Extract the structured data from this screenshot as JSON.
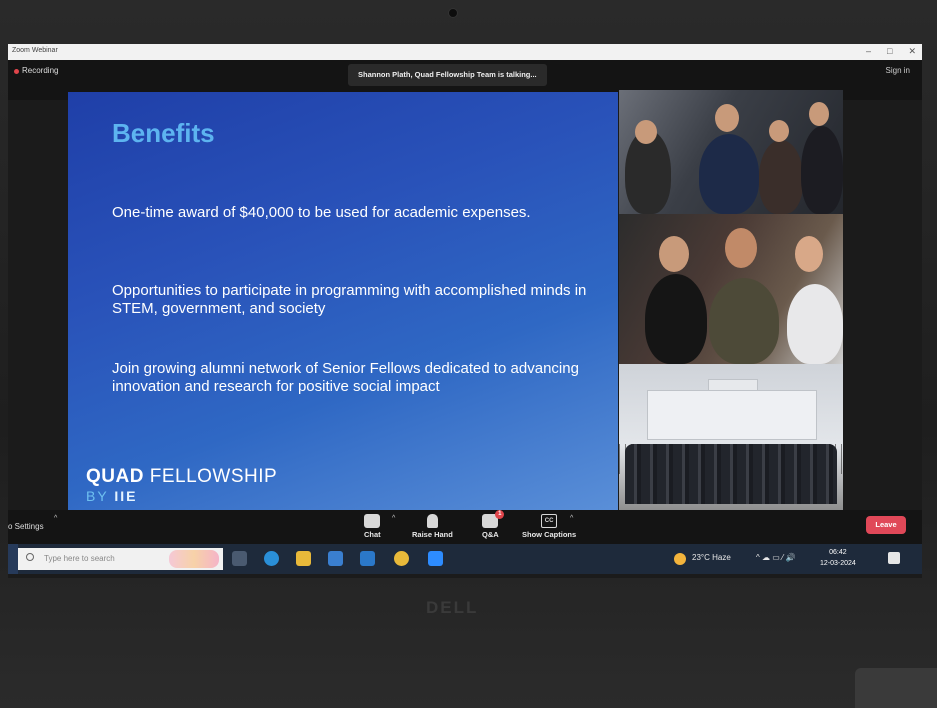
{
  "window": {
    "title": "Zoom Webinar",
    "controls": [
      "–",
      "□",
      "✕"
    ]
  },
  "zoom_top": {
    "recording_label": "Recording",
    "talking_banner": "Shannon Plath, Quad Fellowship Team is talking...",
    "signin_label": "Sign in"
  },
  "slide": {
    "title": "Benefits",
    "benefits": [
      "One-time award of $40,000 to be used for academic expenses.",
      "Opportunities to participate in programming with accomplished minds in STEM, government, and society",
      "Join growing alumni network of Senior Fellows dedicated to advancing innovation and research for positive social impact"
    ],
    "logo_bold": "QUAD",
    "logo_rest": "FELLOWSHIP",
    "logo_by": "BY",
    "logo_org": "IIE"
  },
  "zoom_controls": {
    "video_settings": "o Settings",
    "chat": "Chat",
    "raise_hand": "Raise Hand",
    "qa": "Q&A",
    "qa_badge": "1",
    "captions": "Show Captions",
    "captions_icon": "CC",
    "leave": "Leave"
  },
  "taskbar": {
    "search_placeholder": "Type here to search",
    "weather": "23°C  Haze",
    "time": "06:42",
    "date": "12-03-2024",
    "tray_icons": "^ ☁ ▭ ⁄ 🔊"
  },
  "laptop_brand": "DELL",
  "colors": {
    "slide_title": "#5db4f0",
    "leave_button": "#e04858",
    "recording_dot": "#e0454b"
  }
}
